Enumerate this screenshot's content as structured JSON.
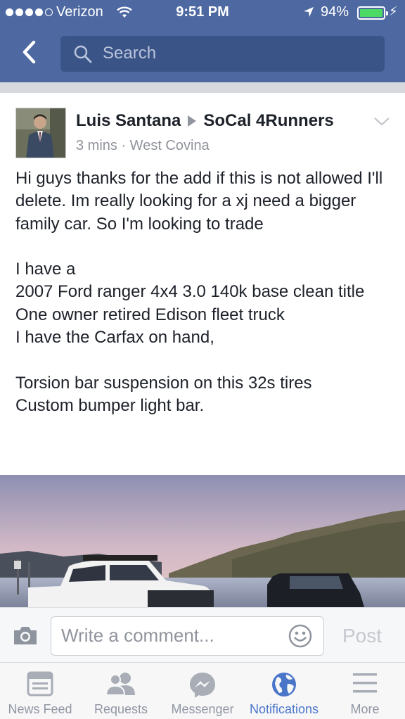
{
  "status_bar": {
    "carrier": "Verizon",
    "time": "9:51 PM",
    "battery": "94%",
    "battery_level": 0.94
  },
  "nav": {
    "back_icon": "chevron-left-icon",
    "search_placeholder": "Search"
  },
  "post": {
    "author": "Luis Santana",
    "group": "SoCal 4Runners",
    "meta": "3 mins · West Covina",
    "body": "Hi guys thanks for the add if this is not allowed I'll delete.  Im really looking for a xj need a bigger family car. So I'm looking to trade\n\nI have a\n2007 Ford ranger 4x4 3.0 140k base clean title\nOne owner retired Edison fleet truck\nI have the Carfax on hand,\n\nTorsion bar suspension on this 32s tires\nCustom bumper light bar."
  },
  "comment_bar": {
    "placeholder": "Write a comment...",
    "post_label": "Post"
  },
  "tabs": [
    {
      "label": "News Feed",
      "icon": "news-feed-icon",
      "active": false
    },
    {
      "label": "Requests",
      "icon": "friend-requests-icon",
      "active": false
    },
    {
      "label": "Messenger",
      "icon": "messenger-icon",
      "active": false
    },
    {
      "label": "Notifications",
      "icon": "globe-icon",
      "active": true
    },
    {
      "label": "More",
      "icon": "menu-icon",
      "active": false
    }
  ],
  "colors": {
    "header": "#4e69a2",
    "search_field": "#3b5487",
    "active_tab": "#4a76c9",
    "inactive_tab": "#9197a3"
  }
}
